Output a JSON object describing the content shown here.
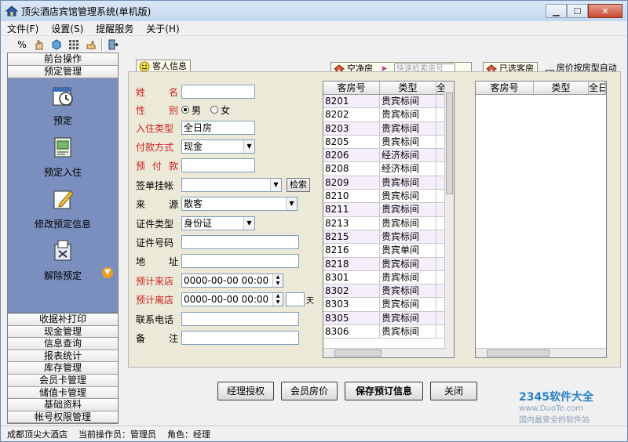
{
  "window": {
    "title": "顶尖酒店宾馆管理系统(单机版)"
  },
  "menu": [
    "文件(F)",
    "设置(S)",
    "提醒服务",
    "关于(H)"
  ],
  "toolbar": {
    "icons": [
      "percent-icon",
      "hand-icon",
      "cube-icon",
      "grid-icon",
      "hand-point-icon",
      "exit-icon"
    ]
  },
  "leftnav": {
    "top_items": [
      "前台操作",
      "预定管理"
    ],
    "tasks": [
      {
        "label": "预定",
        "icon": "clock-calendar-icon"
      },
      {
        "label": "预定入住",
        "icon": "checkin-icon"
      },
      {
        "label": "修改预定信息",
        "icon": "edit-icon"
      },
      {
        "label": "解除预定",
        "icon": "cancel-reservation-icon"
      }
    ],
    "bottom_items": [
      "收据补打印",
      "现金管理",
      "信息查询",
      "报表统计",
      "库存管理",
      "会员卡管理",
      "储值卡管理",
      "基础资料",
      "帐号权限管理"
    ]
  },
  "tabs": {
    "guest_info": "客人信息",
    "empty_rooms": "空净房",
    "quick_search_placeholder": "快速检索房号",
    "selected_rooms": "已选客房",
    "auto_price_label": "房价按房型自动刷"
  },
  "form": {
    "name_label": [
      "姓",
      "名"
    ],
    "name_value": "",
    "gender_label": [
      "性",
      "别"
    ],
    "gender_options": [
      "男",
      "女"
    ],
    "gender_selected": "男",
    "checkin_type_label": "入住类型",
    "checkin_type_value": "全日房",
    "payment_label": "付款方式",
    "payment_value": "现金",
    "deposit_label": [
      "预",
      "付",
      "款"
    ],
    "deposit_value": "",
    "sign_label": "签单挂帐",
    "sign_value": "",
    "search_button": "检索",
    "source_label": [
      "来",
      "源"
    ],
    "source_value": "散客",
    "id_type_label": "证件类型",
    "id_type_value": "身份证",
    "id_number_label": "证件号码",
    "id_number_value": "",
    "address_label": [
      "地",
      "址"
    ],
    "address_value": "",
    "arrival_label": "预计来店",
    "arrival_value": "0000-00-00 00:00",
    "departure_label": "预计离店",
    "departure_value": "0000-00-00 00:00",
    "days_unit": "天",
    "phone_label": "联系电话",
    "phone_value": "",
    "remark_label": [
      "备",
      "注"
    ],
    "remark_value": ""
  },
  "room_table": {
    "headers": [
      "客房号",
      "类型",
      "全"
    ],
    "rows": [
      [
        "8201",
        "贵宾标间"
      ],
      [
        "8202",
        "贵宾标间"
      ],
      [
        "8203",
        "贵宾标间"
      ],
      [
        "8205",
        "贵宾标间"
      ],
      [
        "8206",
        "经济标间"
      ],
      [
        "8208",
        "经济标间"
      ],
      [
        "8209",
        "贵宾标间"
      ],
      [
        "8210",
        "贵宾标间"
      ],
      [
        "8211",
        "贵宾标间"
      ],
      [
        "8213",
        "贵宾标间"
      ],
      [
        "8215",
        "贵宾标间"
      ],
      [
        "8216",
        "贵宾单间"
      ],
      [
        "8218",
        "贵宾标间"
      ],
      [
        "8301",
        "贵宾标间"
      ],
      [
        "8302",
        "贵宾标间"
      ],
      [
        "8303",
        "贵宾标间"
      ],
      [
        "8305",
        "贵宾标间"
      ],
      [
        "8306",
        "贵宾标间"
      ]
    ]
  },
  "selected_table": {
    "headers": [
      "客房号",
      "类型",
      "全日"
    ]
  },
  "actions": [
    "经理授权",
    "会员房价",
    "保存预订信息",
    "关闭"
  ],
  "status": {
    "hotel": "成都顶尖大酒店",
    "operator": "当前操作员：管理员",
    "role": "角色：经理"
  },
  "watermark": {
    "brand": "2345软件大全",
    "url": "www.DuoTe.com",
    "slogan": "国内最安全的软件站"
  }
}
